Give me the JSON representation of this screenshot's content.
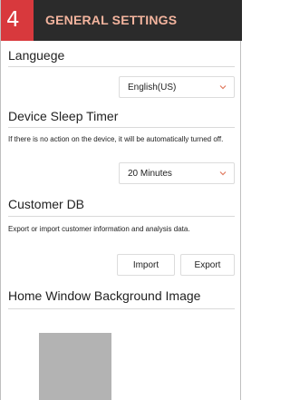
{
  "header": {
    "step": "4",
    "title": "GENERAL SETTINGS"
  },
  "language": {
    "title": "Languege",
    "selected": "English(US)"
  },
  "sleep": {
    "title": "Device Sleep Timer",
    "description": "If there is no action on the device, it will be automatically turned off.",
    "selected": "20 Minutes"
  },
  "customer_db": {
    "title": "Customer DB",
    "description": "Export or import customer information and analysis data.",
    "import_label": "Import",
    "export_label": "Export"
  },
  "background": {
    "title": "Home Window Background Image"
  },
  "icons": {
    "dropdown": "chevron-down-icon"
  },
  "colors": {
    "header_bg": "#2b2b2b",
    "badge_bg": "#d8393d",
    "title_text": "#f3b49e",
    "chevron": "#e07a5f"
  }
}
